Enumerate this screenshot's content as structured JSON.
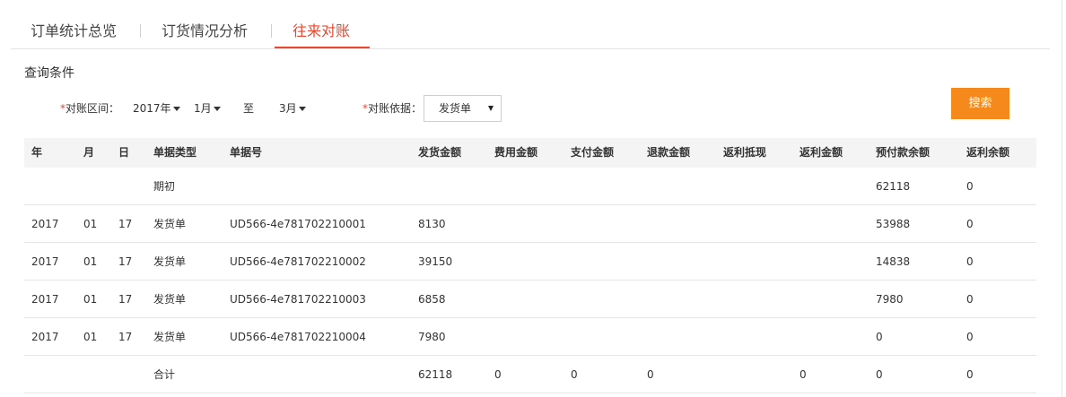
{
  "tabs": [
    {
      "label": "订单统计总览"
    },
    {
      "label": "订货情况分析"
    },
    {
      "label": "往来对账"
    }
  ],
  "section_title": "查询条件",
  "filters": {
    "period_label": "对账区间：",
    "required_mark": "*",
    "year": "2017年",
    "month_from": "1月",
    "to": "至",
    "month_to": "3月",
    "basis_label": "对账依据：",
    "basis_value": "发货单"
  },
  "search_button": "搜索",
  "table": {
    "headers": [
      "年",
      "月",
      "日",
      "单据类型",
      "单据号",
      "发货金额",
      "费用金额",
      "支付金额",
      "退款金额",
      "返利抵现",
      "返利金额",
      "预付款余额",
      "返利余额"
    ],
    "rows": [
      [
        "",
        "",
        "",
        "期初",
        "",
        "",
        "",
        "",
        "",
        "",
        "",
        "62118",
        "0"
      ],
      [
        "2017",
        "01",
        "17",
        "发货单",
        "UD566-4e781702210001",
        "8130",
        "",
        "",
        "",
        "",
        "",
        "53988",
        "0"
      ],
      [
        "2017",
        "01",
        "17",
        "发货单",
        "UD566-4e781702210002",
        "39150",
        "",
        "",
        "",
        "",
        "",
        "14838",
        "0"
      ],
      [
        "2017",
        "01",
        "17",
        "发货单",
        "UD566-4e781702210003",
        "6858",
        "",
        "",
        "",
        "",
        "",
        "7980",
        "0"
      ],
      [
        "2017",
        "01",
        "17",
        "发货单",
        "UD566-4e781702210004",
        "7980",
        "",
        "",
        "",
        "",
        "",
        "0",
        "0"
      ],
      [
        "",
        "",
        "",
        "合计",
        "",
        "62118",
        "0",
        "0",
        "0",
        "",
        "0",
        "0",
        "0"
      ]
    ]
  }
}
